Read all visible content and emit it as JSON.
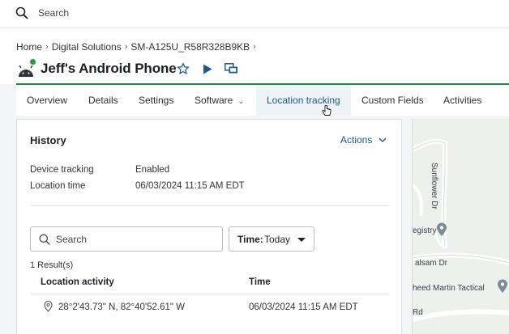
{
  "topbar": {
    "search_label": "Search"
  },
  "breadcrumb": [
    "Home",
    "Digital Solutions",
    "SM-A125U_R58R328B9KB"
  ],
  "device": {
    "title": "Jeff's Android Phone",
    "status_color": "#1e9e3a"
  },
  "tabs": [
    {
      "label": "Overview"
    },
    {
      "label": "Details"
    },
    {
      "label": "Settings"
    },
    {
      "label": "Software",
      "has_dropdown": true
    },
    {
      "label": "Location tracking",
      "active": true
    },
    {
      "label": "Custom Fields"
    },
    {
      "label": "Activities"
    }
  ],
  "history": {
    "title": "History",
    "actions_label": "Actions",
    "fields": [
      {
        "label": "Device tracking",
        "value": "Enabled"
      },
      {
        "label": "Location time",
        "value": "06/03/2024 11:15 AM EDT"
      }
    ],
    "search_placeholder": "Search",
    "time_filter": {
      "label": "Time:",
      "value": "Today"
    },
    "results_count": "1 Result(s)",
    "columns": [
      "Location activity",
      "Time"
    ],
    "rows": [
      {
        "location": "28°2'43.73\" N, 82°40'52.61\" W",
        "time": "06/03/2024 11:15 AM EDT"
      }
    ]
  },
  "map": {
    "labels": [
      "Sunflower Dr",
      "egistry",
      "alsam Dr",
      "heed Martin Tactical",
      "Rd"
    ]
  },
  "colors": {
    "accent": "#1d5a8c",
    "green": "#1e8a3c"
  }
}
